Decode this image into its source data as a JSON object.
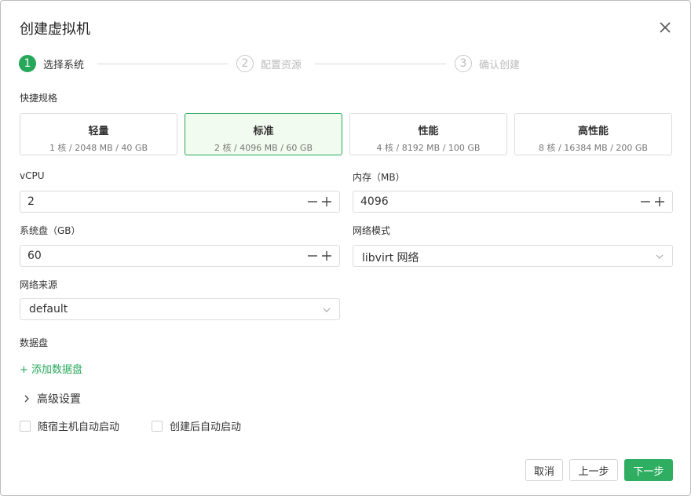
{
  "dialog": {
    "title": "创建虚拟机"
  },
  "steps": [
    {
      "number": "1",
      "label": "选择系统",
      "state": "active"
    },
    {
      "number": "2",
      "label": "配置资源",
      "state": "inactive"
    },
    {
      "number": "3",
      "label": "确认创建",
      "state": "inactive"
    }
  ],
  "presets": {
    "label": "快捷规格",
    "selected": "标准",
    "items": [
      {
        "name": "轻量",
        "spec": "1 核 / 2048 MB / 40 GB"
      },
      {
        "name": "标准",
        "spec": "2 核 / 4096 MB / 60 GB"
      },
      {
        "name": "性能",
        "spec": "4 核 / 8192 MB / 100 GB"
      },
      {
        "name": "高性能",
        "spec": "8 核 / 16384 MB / 200 GB"
      }
    ]
  },
  "form": {
    "vcpu": {
      "label": "vCPU",
      "value": "2"
    },
    "memory": {
      "label": "内存（MB）",
      "value": "4096"
    },
    "disk": {
      "label": "系统盘（GB）",
      "value": "60"
    },
    "network_mode": {
      "label": "网络模式",
      "value": "libvirt 网络"
    },
    "network_source": {
      "label": "网络来源",
      "value": "default"
    },
    "data_disk": {
      "label": "数据盘",
      "add_label": "+ 添加数据盘"
    },
    "advanced_label": "高级设置",
    "autostart_host": {
      "label": "随宿主机自动启动",
      "checked": false
    },
    "autostart_create": {
      "label": "创建后自动启动",
      "checked": false
    }
  },
  "footer": {
    "cancel_label": "取消",
    "prev_label": "上一步",
    "next_label": "下一步"
  },
  "colors": {
    "accent": "#27a75a",
    "selected_bg": "#f2fbef"
  },
  "icons": {
    "close": "close-icon",
    "minus": "minus-icon",
    "plus": "plus-icon",
    "chevron_down": "chevron-down-icon",
    "chevron_right": "chevron-right-icon"
  }
}
